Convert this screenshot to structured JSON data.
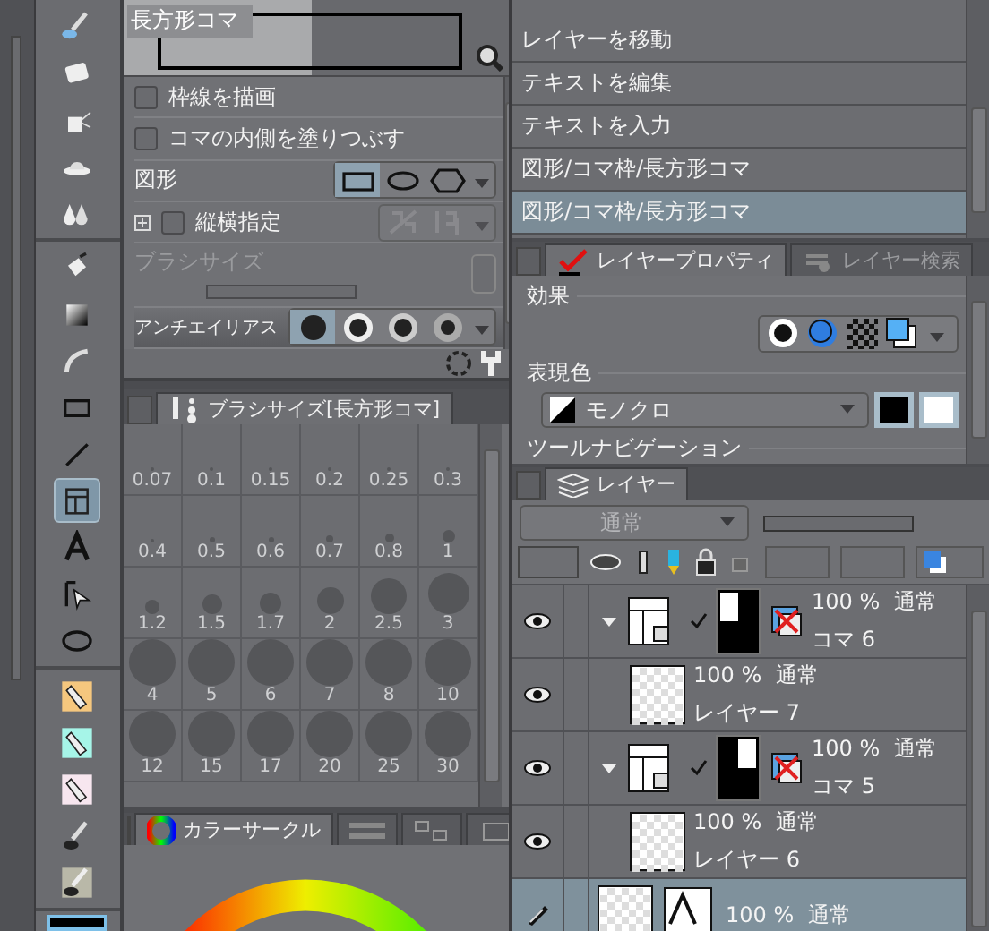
{
  "toolbar": {
    "groups": [
      {
        "tools": [
          {
            "selected": false
          },
          {
            "selected": false
          },
          {
            "selected": false
          },
          {
            "selected": false
          },
          {
            "selected": false
          }
        ]
      },
      {
        "tools": [
          {
            "selected": false
          },
          {
            "selected": false
          },
          {
            "selected": false
          },
          {
            "selected": false
          },
          {
            "selected": false
          },
          {
            "selected": true
          },
          {
            "selected": false
          },
          {
            "selected": false
          },
          {
            "selected": false
          }
        ]
      },
      {
        "tools": [
          {
            "selected": false
          },
          {
            "selected": false
          },
          {
            "selected": false
          },
          {
            "selected": false
          },
          {
            "selected": false
          }
        ]
      }
    ]
  },
  "tool_property": {
    "title": "長方形コマ",
    "options": [
      {
        "kind": "checkbox",
        "label": "枠線を描画",
        "checked": false
      },
      {
        "kind": "checkbox",
        "label": "コマの内側を塗りつぶす",
        "checked": false
      },
      {
        "kind": "shape",
        "label": "図形",
        "choices": [
          {
            "selected": true
          },
          {
            "selected": false
          },
          {
            "selected": false
          }
        ]
      },
      {
        "kind": "aspect",
        "label": "縦横指定",
        "checked": false
      },
      {
        "kind": "size",
        "label": "ブラシサイズ",
        "disabled": true,
        "level": 0
      },
      {
        "kind": "antialias",
        "label": "アンチエイリアス",
        "choices": [
          {
            "selected": true
          },
          {
            "selected": false
          },
          {
            "selected": false
          },
          {
            "selected": false
          }
        ]
      }
    ]
  },
  "brush_size": {
    "tab": "ブラシサイズ[長方形コマ]",
    "sizes": [
      "0.07",
      "0.1",
      "0.15",
      "0.2",
      "0.25",
      "0.3",
      "0.4",
      "0.5",
      "0.6",
      "0.7",
      "0.8",
      "1",
      "1.2",
      "1.5",
      "1.7",
      "2",
      "2.5",
      "3",
      "4",
      "5",
      "6",
      "7",
      "8",
      "10",
      "12",
      "15",
      "17",
      "20",
      "25",
      "30"
    ]
  },
  "color_panel": {
    "tab": "カラーサークル"
  },
  "history": {
    "items": [
      {
        "label": "レイヤーを移動",
        "selected": false
      },
      {
        "label": "テキストを編集",
        "selected": false
      },
      {
        "label": "テキストを入力",
        "selected": false
      },
      {
        "label": "図形/コマ枠/長方形コマ",
        "selected": false
      },
      {
        "label": "図形/コマ枠/長方形コマ",
        "selected": true
      }
    ]
  },
  "layer_property": {
    "tabs": [
      {
        "label": "レイヤープロパティ",
        "selected": true
      },
      {
        "label": "レイヤー検索",
        "selected": false
      }
    ],
    "effect_label": "効果",
    "color_label": "表現色",
    "color_value": "モノクロ",
    "navigation_label": "ツールナビゲーション"
  },
  "layers": {
    "tab": "レイヤー",
    "blend_mode": "通常",
    "opacity_slider": {
      "level": 0
    },
    "items": [
      {
        "kind": "frame",
        "visible": true,
        "expanded": true,
        "opacity": "100 %",
        "blend": "通常",
        "name": "コマ 6",
        "selected": false,
        "children": [
          {
            "kind": "raster",
            "visible": true,
            "opacity": "100 %",
            "blend": "通常",
            "name": "レイヤー 7",
            "selected": false
          }
        ]
      },
      {
        "kind": "frame",
        "visible": true,
        "expanded": true,
        "opacity": "100 %",
        "blend": "通常",
        "name": "コマ 5",
        "selected": false,
        "children": [
          {
            "kind": "raster",
            "visible": true,
            "opacity": "100 %",
            "blend": "通常",
            "name": "レイヤー 6",
            "selected": false
          }
        ]
      },
      {
        "kind": "text",
        "visible": false,
        "opacity": "100 %",
        "blend": "通常",
        "selected": true
      }
    ]
  }
}
